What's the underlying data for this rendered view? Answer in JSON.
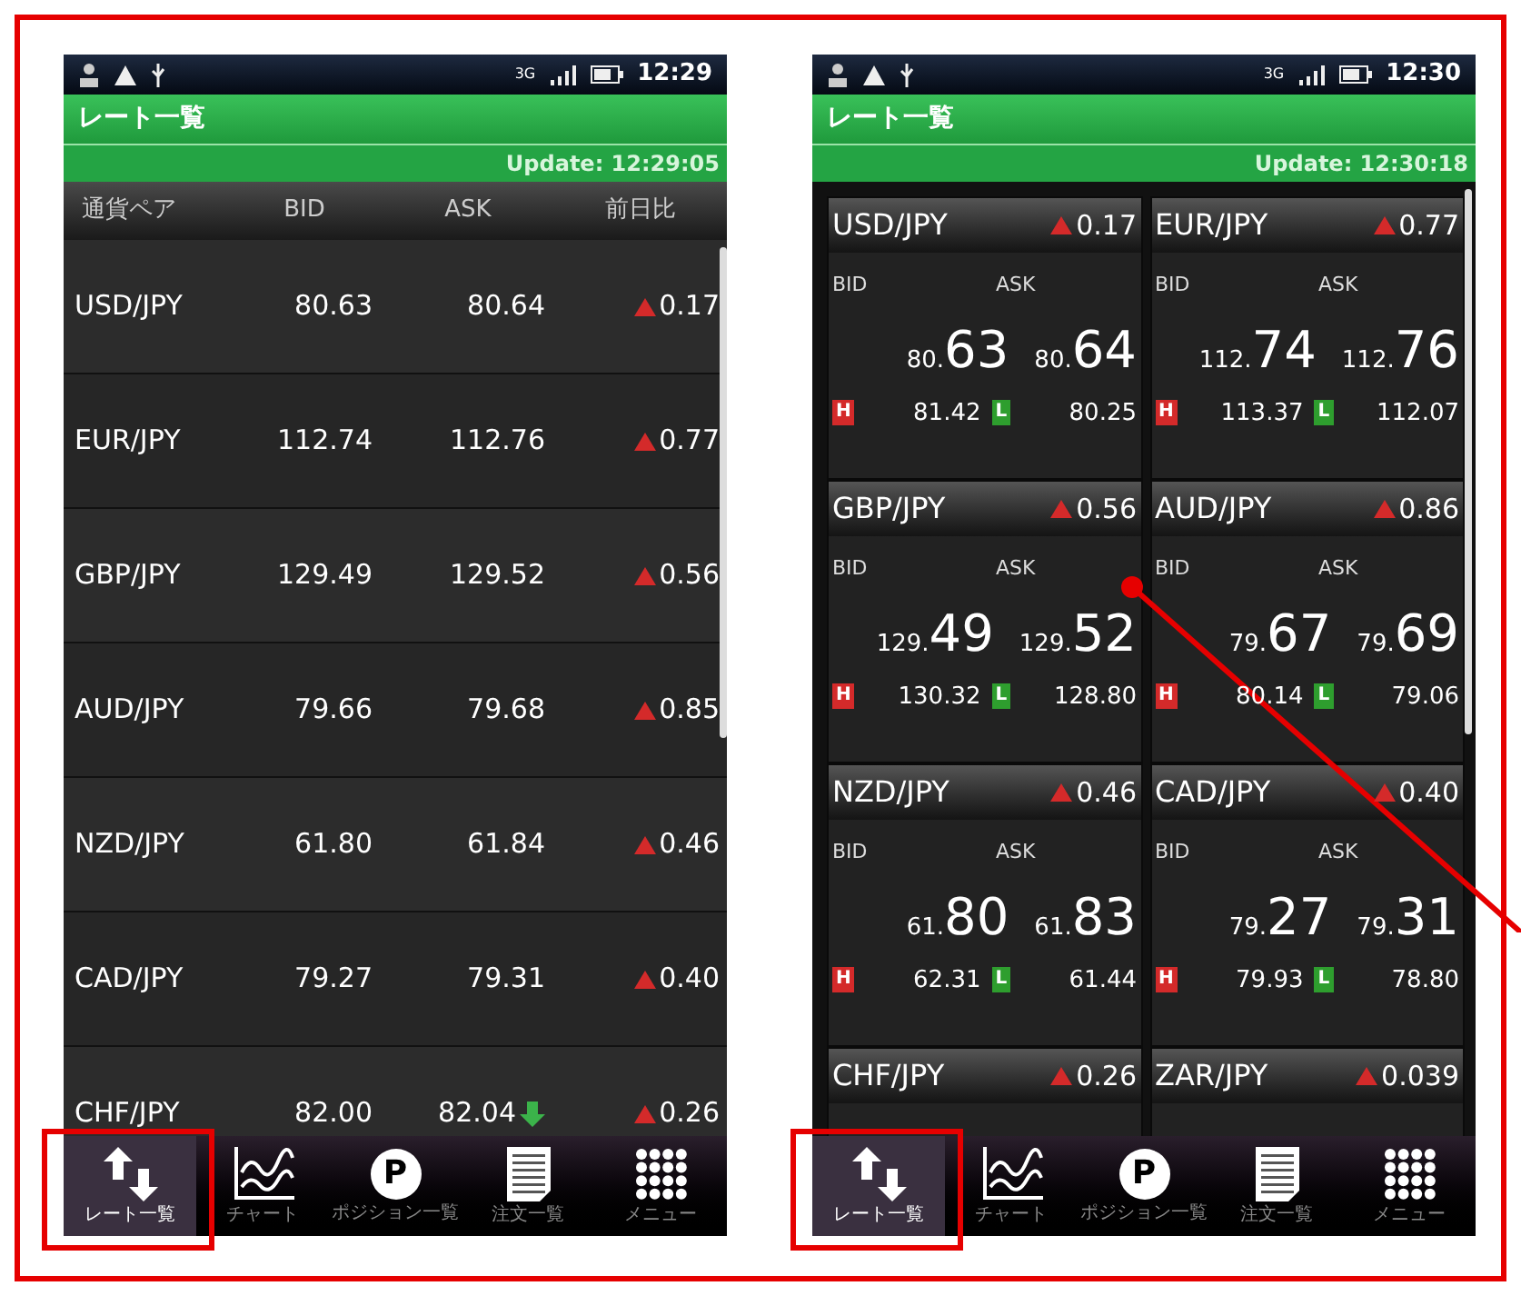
{
  "screens": [
    {
      "kind": "list",
      "status_bar": {
        "network": "3G",
        "time": "12:29"
      },
      "title": "レート一覧",
      "update": "Update: 12:29:05",
      "columns": [
        "通貨ペア",
        "BID",
        "ASK",
        "前日比"
      ],
      "rows": [
        {
          "pair": "USD/JPY",
          "bid": "80.63",
          "ask": "80.64",
          "change": "0.17",
          "rising": true,
          "ask_falling": false
        },
        {
          "pair": "EUR/JPY",
          "bid": "112.74",
          "ask": "112.76",
          "change": "0.77",
          "rising": true,
          "ask_falling": false
        },
        {
          "pair": "GBP/JPY",
          "bid": "129.49",
          "ask": "129.52",
          "change": "0.56",
          "rising": true,
          "ask_falling": false
        },
        {
          "pair": "AUD/JPY",
          "bid": "79.66",
          "ask": "79.68",
          "change": "0.85",
          "rising": true,
          "ask_falling": false
        },
        {
          "pair": "NZD/JPY",
          "bid": "61.80",
          "ask": "61.84",
          "change": "0.46",
          "rising": true,
          "ask_falling": false
        },
        {
          "pair": "CAD/JPY",
          "bid": "79.27",
          "ask": "79.31",
          "change": "0.40",
          "rising": true,
          "ask_falling": false
        },
        {
          "pair": "CHF/JPY",
          "bid": "82.00",
          "ask": "82.04",
          "change": "0.26",
          "rising": true,
          "ask_falling": true
        }
      ],
      "tabs": [
        {
          "label": "レート一覧",
          "selected": true
        },
        {
          "label": "チャート",
          "selected": false
        },
        {
          "glyph": "P",
          "label": "ポジション一覧",
          "selected": false
        },
        {
          "label": "注文一覧",
          "selected": false
        },
        {
          "label": "メニュー",
          "selected": false
        }
      ]
    },
    {
      "kind": "cards",
      "status_bar": {
        "network": "3G",
        "time": "12:30"
      },
      "title": "レート一覧",
      "update": "Update: 12:30:18",
      "cards": [
        {
          "pair": "USD/JPY",
          "change": "0.17",
          "rising": true,
          "bid_label": "BID",
          "ask_label": "ASK",
          "bid_int": "80.",
          "bid_frac": "63",
          "ask_int": "80.",
          "ask_frac": "64",
          "high_label": "H",
          "high": "81.42",
          "low_label": "L",
          "low": "80.25"
        },
        {
          "pair": "EUR/JPY",
          "change": "0.77",
          "rising": true,
          "bid_label": "BID",
          "ask_label": "ASK",
          "bid_int": "112.",
          "bid_frac": "74",
          "ask_int": "112.",
          "ask_frac": "76",
          "high_label": "H",
          "high": "113.37",
          "low_label": "L",
          "low": "112.07"
        },
        {
          "pair": "GBP/JPY",
          "change": "0.56",
          "rising": true,
          "bid_label": "BID",
          "ask_label": "ASK",
          "bid_int": "129.",
          "bid_frac": "49",
          "ask_int": "129.",
          "ask_frac": "52",
          "high_label": "H",
          "high": "130.32",
          "low_label": "L",
          "low": "128.80"
        },
        {
          "pair": "AUD/JPY",
          "change": "0.86",
          "rising": true,
          "bid_label": "BID",
          "ask_label": "ASK",
          "bid_int": "79.",
          "bid_frac": "67",
          "ask_int": "79.",
          "ask_frac": "69",
          "high_label": "H",
          "high": "80.14",
          "low_label": "L",
          "low": "79.06"
        },
        {
          "pair": "NZD/JPY",
          "change": "0.46",
          "rising": true,
          "bid_label": "BID",
          "ask_label": "ASK",
          "bid_int": "61.",
          "bid_frac": "80",
          "ask_int": "61.",
          "ask_frac": "83",
          "high_label": "H",
          "high": "62.31",
          "low_label": "L",
          "low": "61.44"
        },
        {
          "pair": "CAD/JPY",
          "change": "0.40",
          "rising": true,
          "bid_label": "BID",
          "ask_label": "ASK",
          "bid_int": "79.",
          "bid_frac": "27",
          "ask_int": "79.",
          "ask_frac": "31",
          "high_label": "H",
          "high": "79.93",
          "low_label": "L",
          "low": "78.80"
        },
        {
          "pair": "CHF/JPY",
          "change": "0.26",
          "rising": true
        },
        {
          "pair": "ZAR/JPY",
          "change": "0.039",
          "rising": true
        }
      ],
      "tabs": [
        {
          "label": "レート一覧",
          "selected": true
        },
        {
          "label": "チャート",
          "selected": false
        },
        {
          "glyph": "P",
          "label": "ポジション一覧",
          "selected": false
        },
        {
          "label": "注文一覧",
          "selected": false
        },
        {
          "label": "メニュー",
          "selected": false
        }
      ]
    }
  ]
}
